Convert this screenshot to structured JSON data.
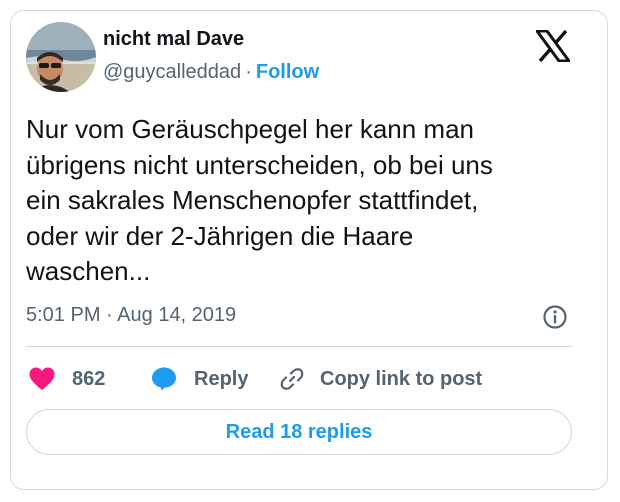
{
  "author": {
    "display_name": "nicht mal Dave",
    "handle": "@guycalleddad",
    "separator": "·",
    "follow_label": "Follow"
  },
  "tweet": {
    "text": "Nur vom Geräuschpegel her kann man\nübrigens nicht unterscheiden, ob bei uns\nein sakrales Menschenopfer stattfindet,\noder wir der 2-Jährigen die Haare\nwaschen...",
    "time": "5:01 PM",
    "separator": "·",
    "date": "Aug 14, 2019"
  },
  "actions": {
    "like_count": "862",
    "reply_label": "Reply",
    "copy_label": "Copy link to post",
    "read_replies_label": "Read 18 replies"
  },
  "icons": {
    "logo": "x-logo-icon",
    "info": "info-icon",
    "like": "heart-icon",
    "reply": "reply-bubble-icon",
    "copy": "link-icon"
  },
  "colors": {
    "accent": "#1d9bf0",
    "like": "#f91880",
    "muted": "#536471",
    "text": "#0f1419",
    "border": "#cfd9de"
  }
}
